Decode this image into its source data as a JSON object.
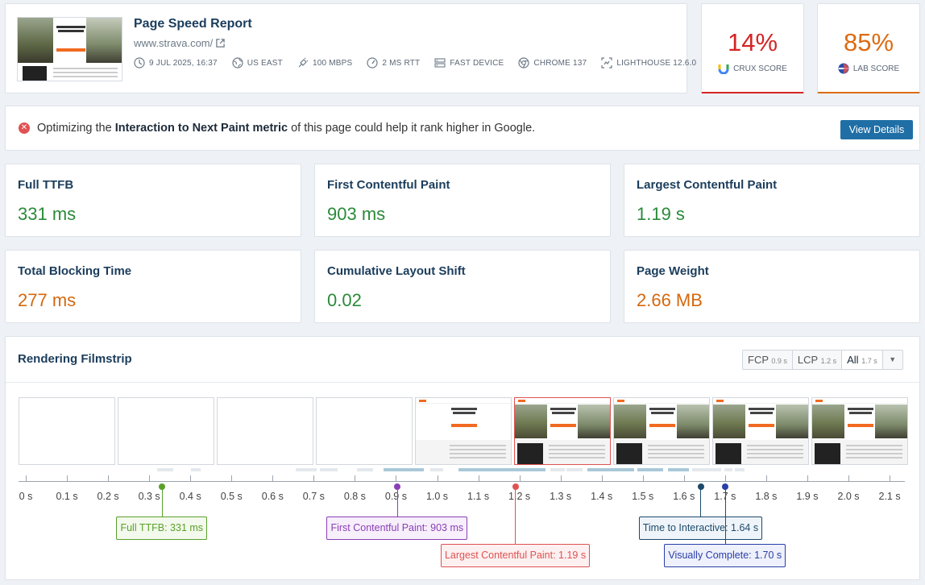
{
  "header": {
    "title": "Page Speed Report",
    "url": "www.strava.com/",
    "meta": [
      {
        "icon": "clock-icon",
        "label": "9 JUL 2025, 16:37"
      },
      {
        "icon": "globe-icon",
        "label": "US EAST"
      },
      {
        "icon": "plug-icon",
        "label": "100 MBPS"
      },
      {
        "icon": "gauge-icon",
        "label": "2 MS RTT"
      },
      {
        "icon": "server-icon",
        "label": "FAST DEVICE"
      },
      {
        "icon": "chrome-icon",
        "label": "CHROME 137"
      },
      {
        "icon": "lighthouse-icon",
        "label": "LIGHTHOUSE 12.6.0"
      }
    ]
  },
  "scores": {
    "crux": {
      "value": "14%",
      "label": "CRUX SCORE",
      "color": "#d52424"
    },
    "lab": {
      "value": "85%",
      "label": "LAB SCORE",
      "color": "#dd6b12"
    }
  },
  "alert": {
    "prefix": "Optimizing the ",
    "bold": "Interaction to Next Paint metric",
    "suffix": " of this page could help it rank higher in Google.",
    "button": "View Details"
  },
  "metrics": [
    {
      "title": "Full TTFB",
      "value": "331 ms",
      "status": "good"
    },
    {
      "title": "First Contentful Paint",
      "value": "903 ms",
      "status": "good"
    },
    {
      "title": "Largest Contentful Paint",
      "value": "1.19 s",
      "status": "good"
    },
    {
      "title": "Total Blocking Time",
      "value": "277 ms",
      "status": "warn"
    },
    {
      "title": "Cumulative Layout Shift",
      "value": "0.02",
      "status": "good"
    },
    {
      "title": "Page Weight",
      "value": "2.66 MB",
      "status": "warn"
    }
  ],
  "filmstrip": {
    "title": "Rendering Filmstrip",
    "options": [
      {
        "label": "FCP",
        "time": "0.9 s",
        "active": false
      },
      {
        "label": "LCP",
        "time": "1.2 s",
        "active": false
      },
      {
        "label": "All",
        "time": "1.7 s",
        "active": true
      }
    ],
    "frames": [
      "blank",
      "blank",
      "blank",
      "blank",
      "partial",
      "full-highlight",
      "full",
      "full",
      "full"
    ],
    "ticks": [
      "0 s",
      "0.1 s",
      "0.2 s",
      "0.3 s",
      "0.4 s",
      "0.5 s",
      "0.6 s",
      "0.7 s",
      "0.8 s",
      "0.9 s",
      "1.0 s",
      "1.1 s",
      "1.2 s",
      "1.3 s",
      "1.4 s",
      "1.5 s",
      "1.6 s",
      "1.7 s",
      "1.8 s",
      "1.9 s",
      "2.0 s",
      "2.1 s"
    ],
    "events": [
      {
        "label": "Full TTFB: 331 ms",
        "time": 0.331,
        "color": "#5aa02c",
        "bg": "#f3f9ec",
        "row": 1
      },
      {
        "label": "First Contentful Paint: 903 ms",
        "time": 0.903,
        "color": "#8a3fb5",
        "bg": "#f7effb",
        "row": 1
      },
      {
        "label": "Largest Contentful Paint: 1.19 s",
        "time": 1.19,
        "color": "#e05252",
        "bg": "#fdf0f0",
        "row": 2
      },
      {
        "label": "Time to Interactive: 1.64 s",
        "time": 1.64,
        "color": "#1d4a6b",
        "bg": "#eef4f9",
        "row": 1
      },
      {
        "label": "Visually Complete: 1.70 s",
        "time": 1.7,
        "color": "#2a3fa8",
        "bg": "#eef0fb",
        "row": 2
      }
    ]
  }
}
